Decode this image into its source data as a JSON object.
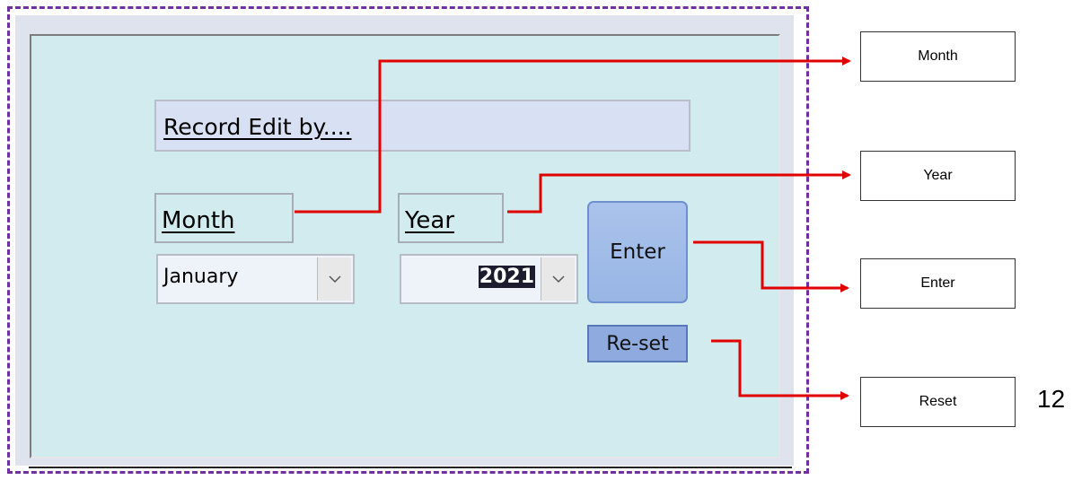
{
  "form": {
    "title": "Record Edit by....",
    "month_label": "Month",
    "year_label": "Year",
    "month_value": "January",
    "year_value": "2021",
    "enter_label": "Enter",
    "reset_label": "Re-set"
  },
  "callouts": {
    "month": "Month",
    "year": "Year",
    "enter": "Enter",
    "reset": "Reset"
  },
  "page_number": "12",
  "icons": [
    "chevron-down-icon"
  ],
  "colors": {
    "frame_dash": "#7030a0",
    "panel_bg": "#d1ebef",
    "title_bg": "#d8e1f3",
    "enter_button": "#a3bde8",
    "reset_button": "#8eaadf",
    "arrow": "#e00000"
  }
}
